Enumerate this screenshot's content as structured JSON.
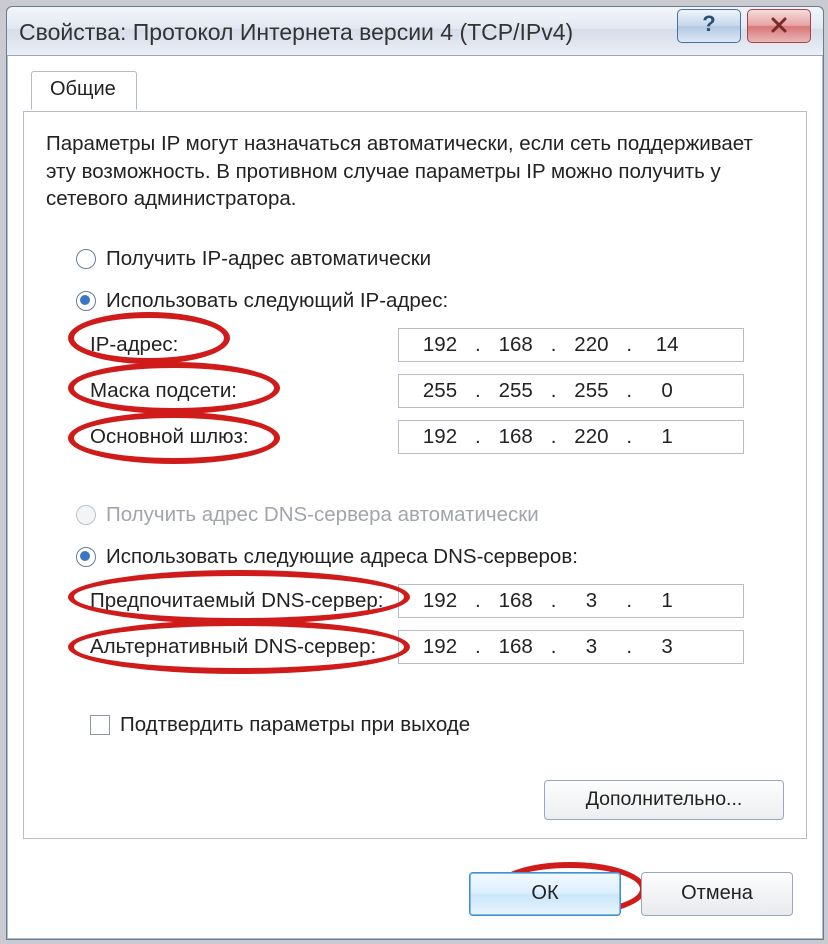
{
  "title": "Свойства: Протокол Интернета версии 4 (TCP/IPv4)",
  "tab": {
    "label": "Общие"
  },
  "description": "Параметры IP могут назначаться автоматически, если сеть поддерживает эту возможность. В противном случае параметры IP можно получить у сетевого администратора.",
  "ip_group": {
    "auto_label": "Получить IP-адрес автоматически",
    "manual_label": "Использовать следующий IP-адрес:",
    "selected": "manual",
    "fields": {
      "ip": {
        "label": "IP-адрес:",
        "a": "192",
        "b": "168",
        "c": "220",
        "d": "14"
      },
      "mask": {
        "label": "Маска подсети:",
        "a": "255",
        "b": "255",
        "c": "255",
        "d": "0"
      },
      "gateway": {
        "label": "Основной шлюз:",
        "a": "192",
        "b": "168",
        "c": "220",
        "d": "1"
      }
    }
  },
  "dns_group": {
    "auto_label": "Получить адрес DNS-сервера автоматически",
    "manual_label": "Использовать следующие адреса DNS-серверов:",
    "selected": "manual",
    "auto_disabled": true,
    "fields": {
      "pref": {
        "label": "Предпочитаемый DNS-сервер:",
        "a": "192",
        "b": "168",
        "c": "3",
        "d": "1"
      },
      "alt": {
        "label": "Альтернативный DNS-сервер:",
        "a": "192",
        "b": "168",
        "c": "3",
        "d": "3"
      }
    }
  },
  "validate": {
    "label": "Подтвердить параметры при выходе",
    "checked": false
  },
  "buttons": {
    "advanced": "Дополнительно...",
    "ok": "ОК",
    "cancel": "Отмена"
  }
}
